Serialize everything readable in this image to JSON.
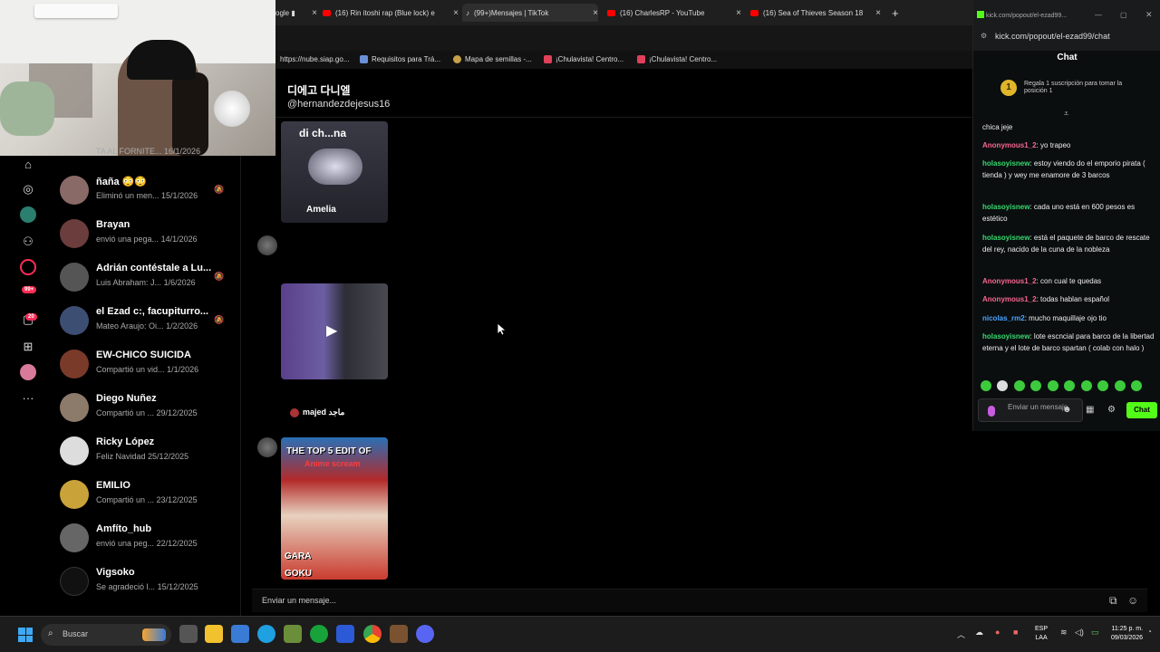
{
  "browser": {
    "tabs": [
      {
        "label": "ogle ▮"
      },
      {
        "label": "(16) Rin itoshi rap (Blue lock) e"
      },
      {
        "label": "(99+)Mensajes | TikTok"
      },
      {
        "label": "(16) CharlesRP - YouTube"
      },
      {
        "label": "(16) Sea of Thieves Season 18"
      }
    ],
    "new_tab": "+",
    "bookmarks": [
      {
        "label": "https://nube.siap.go..."
      },
      {
        "label": "Requisitos para Trá..."
      },
      {
        "label": "Mapa de semillas -..."
      },
      {
        "label": "¡Chulavista! Centro..."
      },
      {
        "label": "¡Chulavista! Centro..."
      }
    ]
  },
  "rail": {
    "badge_99": "99+",
    "badge_20": "20"
  },
  "conversations": [
    {
      "name": "",
      "preview": "TA AL FORNITE...",
      "date": "16/1/2026"
    },
    {
      "name": "ñaña 😳😳",
      "preview": "Eliminó un men...",
      "date": "15/1/2026",
      "muted": true
    },
    {
      "name": "Brayan",
      "preview": "envió una pega...",
      "date": "14/1/2026"
    },
    {
      "name": "Adrián contéstale a Lu...",
      "preview": "Luis Abraham: J...",
      "date": "1/6/2026",
      "muted": true
    },
    {
      "name": "el Ezad c:, facupiturro...",
      "preview": "Mateo Araujo: Oi...",
      "date": "1/2/2026",
      "muted": true
    },
    {
      "name": "EW-CHICO SUICIDA",
      "preview": "Compartió un vid...",
      "date": "1/1/2026"
    },
    {
      "name": "Diego Nuñez",
      "preview": "Compartió un ...",
      "date": "29/12/2025"
    },
    {
      "name": "Ricky López",
      "preview": "Feliz Navidad",
      "date": "25/12/2025"
    },
    {
      "name": "EMILIO",
      "preview": "Compartió un ...",
      "date": "23/12/2025"
    },
    {
      "name": "Amfíto_hub",
      "preview": "envió una peg...",
      "date": "22/12/2025"
    },
    {
      "name": "Vigsoko",
      "preview": "Se agradeció l...",
      "date": "15/12/2025"
    }
  ],
  "chat": {
    "name": "디에고 다니엘",
    "handle": "@hernandezdejesus16",
    "videos": [
      {
        "caption": "di ch...na",
        "author": "Amelia"
      },
      {
        "author": "majed ماجد"
      },
      {
        "caption_top": "THE TOP 5 EDIT OF",
        "caption_sub": "Anime scream",
        "caption_bottom": "GARA",
        "caption_bottom2": "GOKU"
      }
    ],
    "input_placeholder": "Enviar un mensaje..."
  },
  "kick": {
    "window_title": "kick.com/popout/el-ezad99...",
    "url": "kick.com/popout/el-ezad99/chat",
    "chat_label": "Chat",
    "promo": "Regala 1 suscripción para tomar la posición 1",
    "messages": [
      {
        "user": "",
        "text": "chica jeje"
      },
      {
        "user": "Anonymous1_2",
        "text": ": yo trapeo",
        "color": "#f86590"
      },
      {
        "user": "holasoyisnew",
        "text": ": estoy viendo do el emporio pirata ( tienda ) y wey me enamore de 3 barcos",
        "color": "#36d96e"
      },
      {
        "user": "holasoyisnew",
        "text": ": cada uno está en 600 pesos es estético",
        "color": "#36d96e"
      },
      {
        "user": "holasoyisnew",
        "text": ": está el paquete de barco de rescate del rey, nacido de la cuna de la nobleza",
        "color": "#36d96e"
      },
      {
        "user": "Anonymous1_2",
        "text": ": con cual te quedas",
        "color": "#f86590"
      },
      {
        "user": "Anonymous1_2",
        "text": ": todas hablan español",
        "color": "#f86590"
      },
      {
        "user": "nicolas_rm2",
        "text": ": mucho maquillaje ojo tio",
        "color": "#4aa3ff"
      },
      {
        "user": "holasoyisnew",
        "text": ": lote escncial para barco de la libertad eterna y el lote de barco spartan ( colab con halo )",
        "color": "#36d96e"
      }
    ],
    "input_placeholder": "Enviar un mensaje",
    "send_label": "Chat"
  },
  "taskbar": {
    "search_label": "Buscar",
    "lang_top": "ESP",
    "lang_bottom": "LAA",
    "time": "11:25 p. m.",
    "date": "09/03/2026"
  },
  "colors": {
    "tiktok_red": "#fe2c55",
    "kick_green": "#53fc18"
  }
}
